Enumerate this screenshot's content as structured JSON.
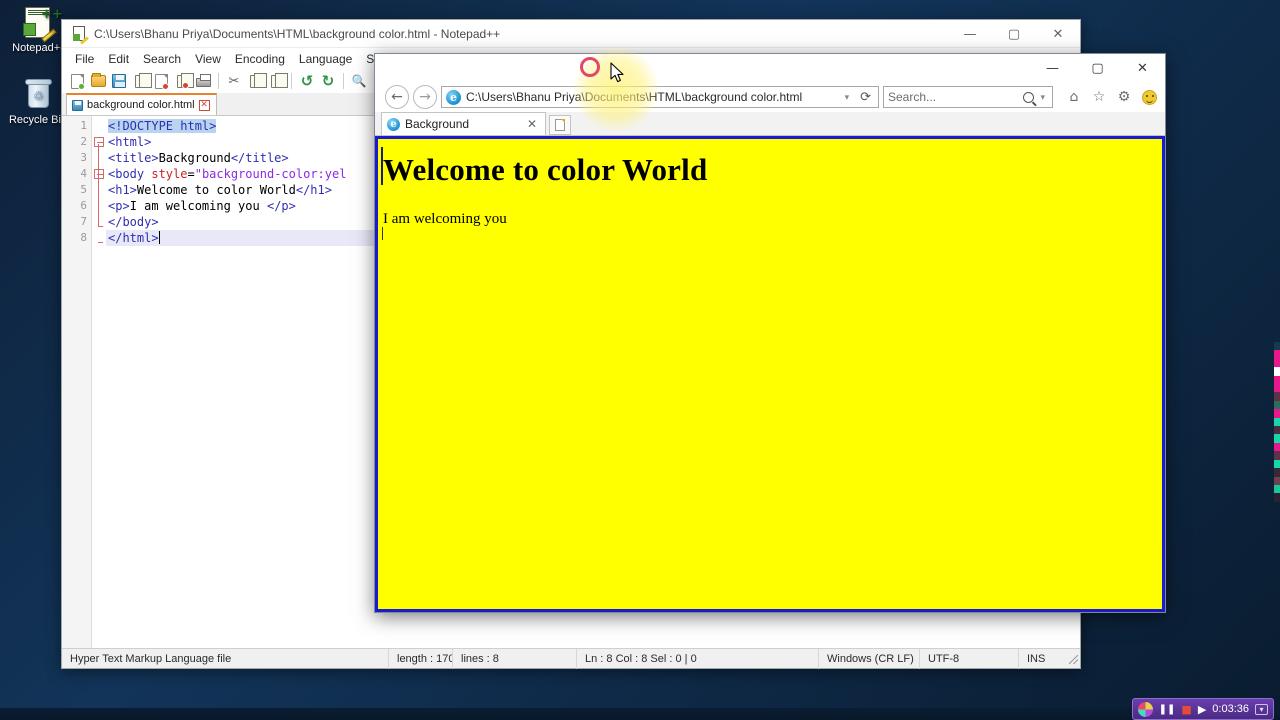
{
  "desktop": {
    "icons": [
      {
        "name": "notepadpp",
        "label": "Notepad+-"
      },
      {
        "name": "recycle-bin",
        "label": "Recycle Bin"
      }
    ]
  },
  "notepad": {
    "title": "C:\\Users\\Bhanu Priya\\Documents\\HTML\\background color.html - Notepad++",
    "window_controls": {
      "minimize": "—",
      "maximize": "▢",
      "close": "✕"
    },
    "menu": [
      "File",
      "Edit",
      "Search",
      "View",
      "Encoding",
      "Language",
      "Setting"
    ],
    "toolbar": [
      "new-file-icon",
      "open-file-icon",
      "save-icon",
      "save-all-icon",
      "close-file-icon",
      "close-all-icon",
      "print-icon",
      "cut-icon",
      "copy-icon",
      "paste-icon",
      "undo-icon",
      "redo-icon",
      "find-icon"
    ],
    "tab": {
      "label": "background color.html",
      "close": "✕"
    },
    "line_numbers": [
      "1",
      "2",
      "3",
      "4",
      "5",
      "6",
      "7",
      "8"
    ],
    "code": [
      {
        "n": 1,
        "parts": [
          {
            "t": "<!DOCTYPE html>",
            "c": "doctype-sel"
          }
        ]
      },
      {
        "n": 2,
        "parts": [
          {
            "t": "<html>",
            "c": "tag"
          }
        ]
      },
      {
        "n": 3,
        "parts": [
          {
            "t": "<title>",
            "c": "tag"
          },
          {
            "t": "Background",
            "c": "txt"
          },
          {
            "t": "</title>",
            "c": "tag"
          }
        ]
      },
      {
        "n": 4,
        "parts": [
          {
            "t": "<body ",
            "c": "tag"
          },
          {
            "t": "style",
            "c": "attr"
          },
          {
            "t": "=",
            "c": "txt"
          },
          {
            "t": "\"background-color:yel",
            "c": "val"
          }
        ]
      },
      {
        "n": 5,
        "parts": [
          {
            "t": "<h1>",
            "c": "tag"
          },
          {
            "t": "Welcome to color World",
            "c": "txt"
          },
          {
            "t": "</h1>",
            "c": "tag"
          }
        ]
      },
      {
        "n": 6,
        "parts": [
          {
            "t": "<p>",
            "c": "tag"
          },
          {
            "t": "I am welcoming you ",
            "c": "txt"
          },
          {
            "t": "</p>",
            "c": "tag"
          }
        ]
      },
      {
        "n": 7,
        "parts": [
          {
            "t": "</body>",
            "c": "tag"
          }
        ]
      },
      {
        "n": 8,
        "parts": [
          {
            "t": "</html>",
            "c": "tag"
          }
        ]
      }
    ],
    "status": {
      "filetype": "Hyper Text Markup Language file",
      "length": "length : 170",
      "lines": "lines : 8",
      "position": "Ln : 8   Col : 8   Sel : 0 | 0",
      "eol": "Windows (CR LF)",
      "encoding": "UTF-8",
      "insert_mode": "INS"
    }
  },
  "browser": {
    "window_controls": {
      "minimize": "—",
      "maximize": "▢",
      "close": "✕"
    },
    "back_arrow": "←",
    "forward_arrow": "→",
    "address": "C:\\Users\\Bhanu Priya\\Documents\\HTML\\background color.html",
    "address_dropdown": "▾",
    "refresh": "⟳",
    "search_placeholder": "Search...",
    "search_dropdown": "▾",
    "tool_icons": [
      "home-icon",
      "favorites-star-icon",
      "gear-icon",
      "smiley-icon"
    ],
    "home_glyph": "⌂",
    "star_glyph": "☆",
    "gear_glyph": "⚙",
    "tab": {
      "label": "Background",
      "close": "✕"
    },
    "new_tab": "new-tab-icon",
    "page": {
      "heading": "Welcome to color World",
      "paragraph": "I am welcoming you",
      "background_color": "#ffff00",
      "border_color": "#1a1ad0"
    }
  },
  "recorder": {
    "pause": "❚❚",
    "stop": "■",
    "play": "▶",
    "time": "0:03:36",
    "minimize": "▾"
  },
  "filmstrip": {
    "colors": [
      "#143a52",
      "#e8188c",
      "#e8188c",
      "#ffffff",
      "#e8188c",
      "#e8188c",
      "#5c3348",
      "#2b6e5e",
      "#e8188c",
      "#18d8a8",
      "#4a2c3c",
      "#18d8a8",
      "#e8188c",
      "#5c3348",
      "#18d8a8",
      "#3a2836",
      "#6a4250",
      "#18c898",
      "#2a2230"
    ]
  }
}
